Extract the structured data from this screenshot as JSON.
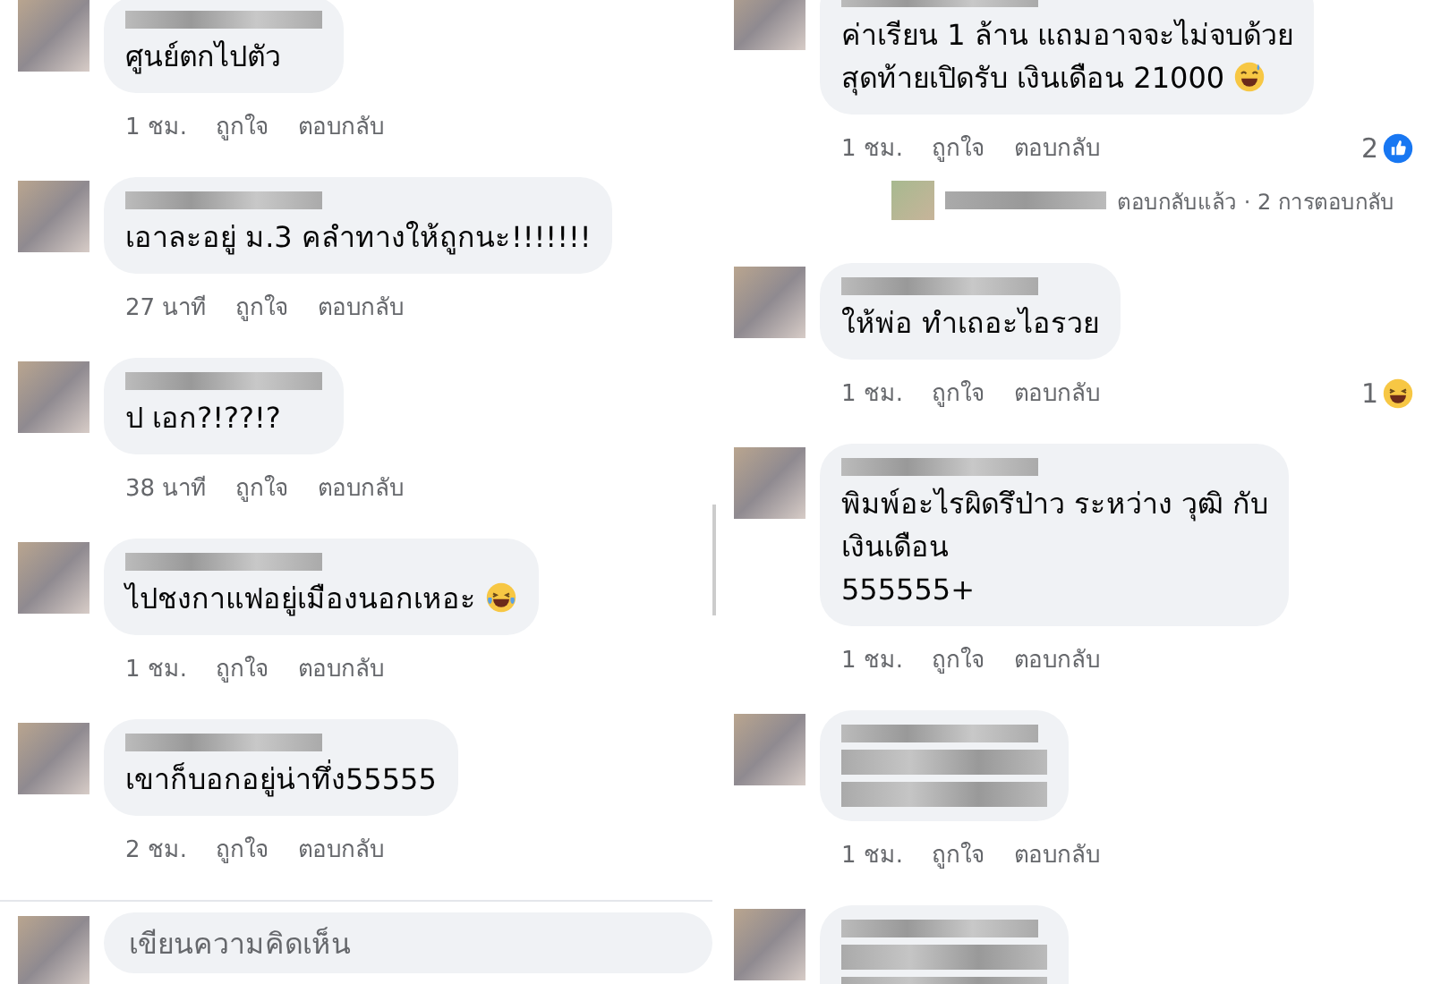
{
  "columns": [
    {
      "comments": [
        {
          "kind": "text",
          "text": "ศูนย์ตกไปตัว",
          "time": "1 ชม.",
          "like": "ถูกใจ",
          "reply": "ตอบกลับ"
        },
        {
          "kind": "text",
          "text": "เอาละอยู่ ม.3 คลำทางให้ถูกนะ!!!!!!!",
          "time": "27 นาที",
          "like": "ถูกใจ",
          "reply": "ตอบกลับ"
        },
        {
          "kind": "text",
          "text": "ป เอก?!??!?",
          "time": "38 นาที",
          "like": "ถูกใจ",
          "reply": "ตอบกลับ"
        },
        {
          "kind": "text",
          "text": "ไปชงกาแฟอยู่เมืองนอกเหอะ",
          "emoji": {
            "kind": "tears-of-joy"
          },
          "time": "1 ชม.",
          "like": "ถูกใจ",
          "reply": "ตอบกลับ"
        },
        {
          "kind": "text",
          "text": "เขาก็บอกอยู่น่าทึ่ง55555",
          "time": "2 ชม.",
          "like": "ถูกใจ",
          "reply": "ตอบกลับ"
        }
      ],
      "composer": {
        "placeholder": "เขียนความคิดเห็น"
      }
    },
    {
      "comments": [
        {
          "kind": "text",
          "text": "ค่าเรียน 1 ล้าน แถมอาจจะไม่จบด้วย\nสุดท้ายเปิดรับ เงินเดือน 21000",
          "emoji": {
            "kind": "sweat-smile"
          },
          "time": "1 ชม.",
          "like": "ถูกใจ",
          "reply": "ตอบกลับ",
          "reaction": {
            "kind": "like",
            "count": "2"
          },
          "replies": "ตอบกลับแล้ว · 2 การตอบกลับ"
        },
        {
          "kind": "text",
          "text": "ให้พ่อ  ทำเถอะไอรวย",
          "time": "1 ชม.",
          "like": "ถูกใจ",
          "reply": "ตอบกลับ",
          "reaction": {
            "kind": "haha",
            "count": "1"
          }
        },
        {
          "kind": "text",
          "text": "พิมพ์อะไรผิดรึป่าว ระหว่าง วุฒิ กับ\nเงินเดือน\n555555+",
          "time": "1 ชม.",
          "like": "ถูกใจ",
          "reply": "ตอบกลับ"
        },
        {
          "kind": "blurred",
          "time": "1 ชม.",
          "like": "ถูกใจ",
          "reply": "ตอบกลับ"
        },
        {
          "kind": "blurred"
        }
      ]
    }
  ]
}
